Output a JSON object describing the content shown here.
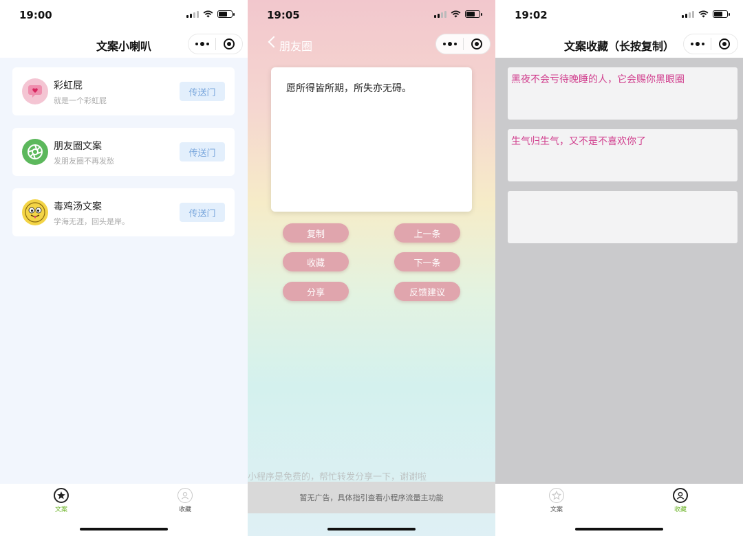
{
  "phone1": {
    "status_time": "19:00",
    "nav_title": "文案小喇叭",
    "cards": [
      {
        "title": "彩虹屁",
        "sub": "就是一个彩虹屁",
        "button": "传送门"
      },
      {
        "title": "朋友圈文案",
        "sub": "发朋友圈不再发愁",
        "button": "传送门"
      },
      {
        "title": "毒鸡汤文案",
        "sub": "学海无涯，回头是岸。",
        "button": "传送门"
      }
    ],
    "tabs": [
      {
        "label": "文案",
        "icon": "star-icon",
        "active": true
      },
      {
        "label": "收藏",
        "icon": "user-icon",
        "active": false
      }
    ]
  },
  "phone2": {
    "status_time": "19:05",
    "nav_title": "朋友圈",
    "quote": "愿所得皆所期，所失亦无碍。",
    "buttons": {
      "copy": "复制",
      "prev": "上一条",
      "favorite": "收藏",
      "next": "下一条",
      "share": "分享",
      "feedback": "反馈建议"
    },
    "share_tip": "小程序是免费的，帮忙转发分享一下，谢谢啦",
    "ad_text": "暂无广告，具体指引查看小程序流量主功能"
  },
  "phone3": {
    "status_time": "19:02",
    "nav_title": "文案收藏（长按复制）",
    "items": [
      "黑夜不会亏待晚睡的人，它会赐你黑眼圈",
      "生气归生气，又不是不喜欢你了",
      ""
    ],
    "tabs": [
      {
        "label": "文案",
        "icon": "star-icon",
        "active": false
      },
      {
        "label": "收藏",
        "icon": "user-icon",
        "active": true
      }
    ]
  },
  "colors": {
    "tab_active": "#6fb52c",
    "tab_inactive": "#888888",
    "button_pink": "#e0a5ad",
    "fav_text": "#d13f8e",
    "portal_button_bg": "#e3effc"
  }
}
